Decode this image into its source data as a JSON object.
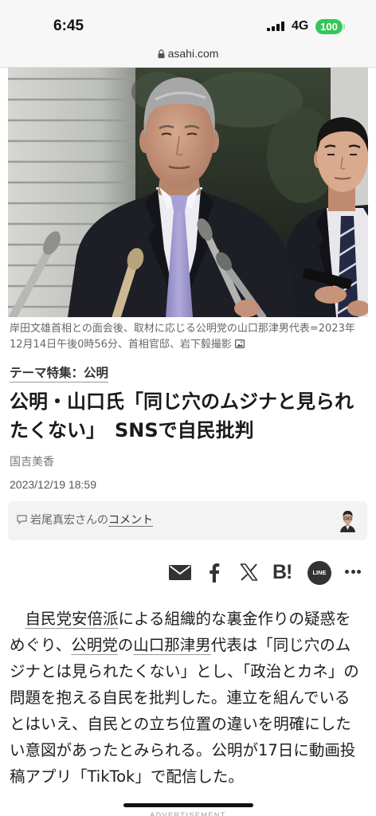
{
  "status_bar": {
    "time": "6:45",
    "network": "4G",
    "battery": "100",
    "signal_bars": 4
  },
  "url_bar": {
    "domain": "asahi.com",
    "icon": "lock-icon"
  },
  "photo": {
    "caption": "岸田文雄首相との面会後、取材に応じる公明党の山口那津男代表=2023年12月14日午後0時56分、首相官邸、岩下毅撮影",
    "caption_icon": "image-icon"
  },
  "article": {
    "theme_tag": "テーマ特集：公明",
    "title": "公明・山口氏「同じ穴のムジナと見られたくない」　SNSで自民批判",
    "author": "国吉美香",
    "date": "2023/12/19 18:59",
    "comment": {
      "icon": "speech-bubble-icon",
      "commenter": "岩尾真宏さんの",
      "link": "コメント"
    },
    "share": [
      {
        "icon": "mail-icon"
      },
      {
        "icon": "facebook-icon"
      },
      {
        "icon": "x-icon"
      },
      {
        "icon": "hatena-bookmark-icon",
        "glyph": "B!"
      },
      {
        "icon": "line-icon",
        "glyph": "LINE"
      },
      {
        "icon": "more-icon"
      }
    ],
    "body": [
      {
        "text": "　"
      },
      {
        "text": "自民党安倍派",
        "link": true
      },
      {
        "text": "による組織的な裏金作りの疑惑をめぐり、"
      },
      {
        "text": "公明党",
        "link": true
      },
      {
        "text": "の"
      },
      {
        "text": "山口那津男",
        "link": true
      },
      {
        "text": "代表は「同じ穴のムジナとは見られたくない」とし、「政治とカネ」の問題を抱える自民を批判した。連立を組んでいるとはいえ、自民との立ち位置の違いを明確にしたい意図があったとみられる。公明が17日に動画投稿アプリ「TikTok」で配信した。"
      }
    ]
  },
  "footer": {
    "ad_label": "ADVERTISEMENT"
  },
  "colors": {
    "battery": "#34c759",
    "text": "#1e1e1e",
    "caption": "#666666",
    "comment_bg": "#f3f3f3",
    "tie": "#9d95cc"
  }
}
